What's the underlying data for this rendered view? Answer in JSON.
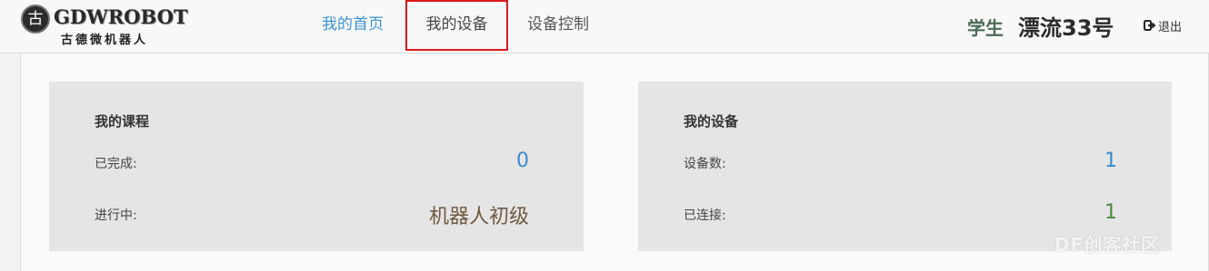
{
  "header": {
    "logo": {
      "glyph": "古",
      "name_en": "GDWROBOT",
      "name_cn": "古德微机器人"
    },
    "nav": {
      "home": "我的首页",
      "devices": "我的设备",
      "control": "设备控制"
    },
    "user": {
      "role": "学生",
      "name": "漂流33号"
    },
    "logout": {
      "icon": "logout-icon",
      "label": "退出"
    }
  },
  "courses_card": {
    "title": "我的课程",
    "completed_label": "已完成:",
    "completed_value": "0",
    "in_progress_label": "进行中:",
    "in_progress_value": "机器人初级"
  },
  "devices_card": {
    "title": "我的设备",
    "count_label": "设备数:",
    "count_value": "1",
    "connected_label": "已连接:",
    "connected_value": "1"
  },
  "watermark": "DF创客社区",
  "colors": {
    "nav_active": "#3a94d4",
    "highlight_border": "#d9191c",
    "value_blue": "#3a8ad0",
    "value_green": "#4b8a3a",
    "card_bg": "#e5e5e5"
  }
}
